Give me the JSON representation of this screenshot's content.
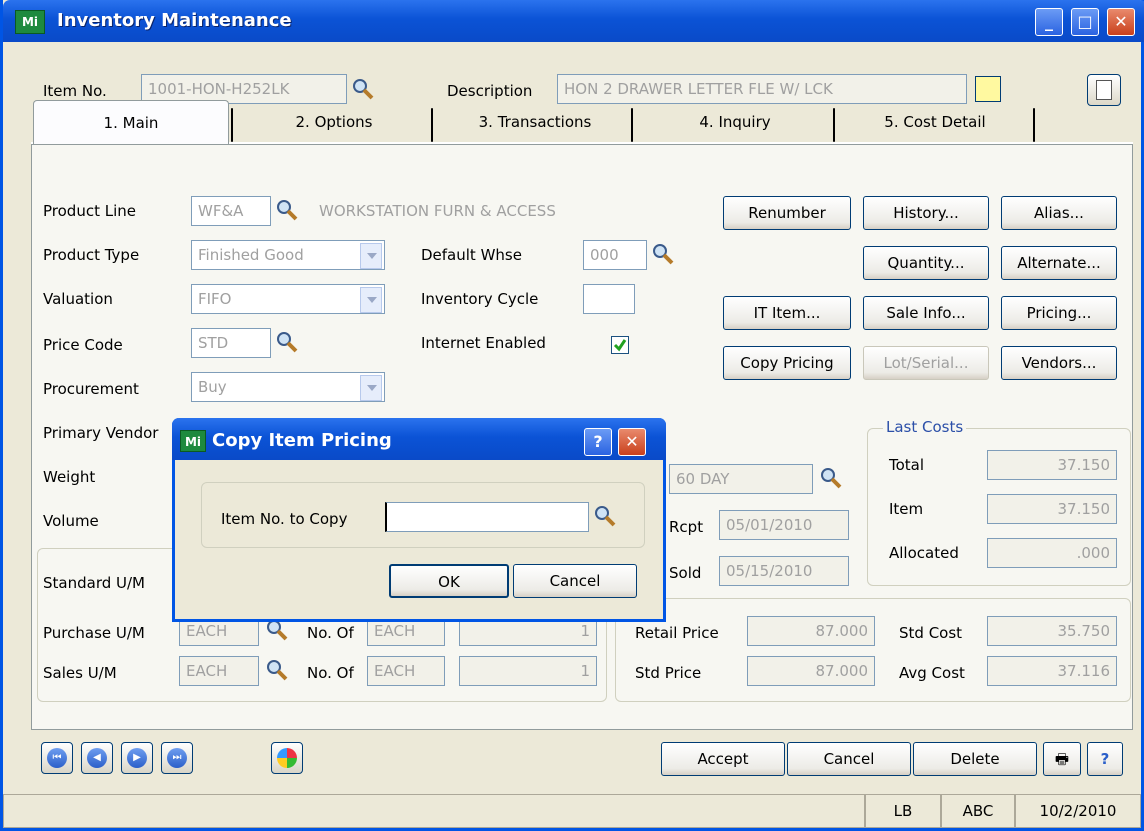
{
  "window": {
    "title": "Inventory Maintenance",
    "icon_text": "Mi"
  },
  "header": {
    "item_no_label": "Item No.",
    "item_no_value": "1001-HON-H252LK",
    "description_label": "Description",
    "description_value": "HON 2 DRAWER LETTER FLE W/ LCK"
  },
  "tabs": [
    {
      "label": "1. Main"
    },
    {
      "label": "2. Options"
    },
    {
      "label": "3. Transactions"
    },
    {
      "label": "4. Inquiry"
    },
    {
      "label": "5. Cost Detail"
    }
  ],
  "main": {
    "product_line_label": "Product Line",
    "product_line_value": "WF&A",
    "product_line_desc": "WORKSTATION FURN & ACCESS",
    "product_type_label": "Product Type",
    "product_type_value": "Finished Good",
    "valuation_label": "Valuation",
    "valuation_value": "FIFO",
    "price_code_label": "Price Code",
    "price_code_value": "STD",
    "procurement_label": "Procurement",
    "procurement_value": "Buy",
    "primary_vendor_label": "Primary Vendor",
    "weight_label": "Weight",
    "volume_label": "Volume",
    "default_whse_label": "Default Whse",
    "default_whse_value": "000",
    "inventory_cycle_label": "Inventory Cycle",
    "inventory_cycle_value": "",
    "internet_enabled_label": "Internet Enabled",
    "terms_value": "60 DAY",
    "rcpt_label": "Rcpt",
    "rcpt_value": "05/01/2010",
    "sold_label": "Sold",
    "sold_value": "05/15/2010",
    "standard_um_label": "Standard U/M",
    "purchase_um_label": "Purchase U/M",
    "purchase_um_value": "EACH",
    "purchase_noof_label": "No. Of",
    "purchase_noof_value": "EACH",
    "purchase_qty": "1",
    "sales_um_label": "Sales U/M",
    "sales_um_value": "EACH",
    "sales_noof_label": "No. Of",
    "sales_noof_value": "EACH",
    "sales_qty": "1",
    "retail_price_label": "Retail Price",
    "retail_price_value": "87.000",
    "std_price_label": "Std Price",
    "std_price_value": "87.000",
    "std_cost_label": "Std Cost",
    "std_cost_value": "35.750",
    "avg_cost_label": "Avg Cost",
    "avg_cost_value": "37.116"
  },
  "last_costs": {
    "title": "Last Costs",
    "total_label": "Total",
    "total_value": "37.150",
    "item_label": "Item",
    "item_value": "37.150",
    "allocated_label": "Allocated",
    "allocated_value": ".000"
  },
  "buttons": {
    "renumber": "Renumber",
    "history": "History...",
    "alias": "Alias...",
    "quantity": "Quantity...",
    "alternate": "Alternate...",
    "it_item": "IT Item...",
    "sale_info": "Sale Info...",
    "pricing": "Pricing...",
    "copy_pricing": "Copy Pricing",
    "lot_serial": "Lot/Serial...",
    "vendors": "Vendors..."
  },
  "dialog": {
    "title": "Copy Item Pricing",
    "field_label": "Item No. to Copy",
    "field_value": "",
    "ok": "OK",
    "cancel": "Cancel",
    "help": "?"
  },
  "footer": {
    "accept": "Accept",
    "cancel": "Cancel",
    "delete": "Delete"
  },
  "statusbar": {
    "unit": "LB",
    "company": "ABC",
    "date": "10/2/2010"
  }
}
